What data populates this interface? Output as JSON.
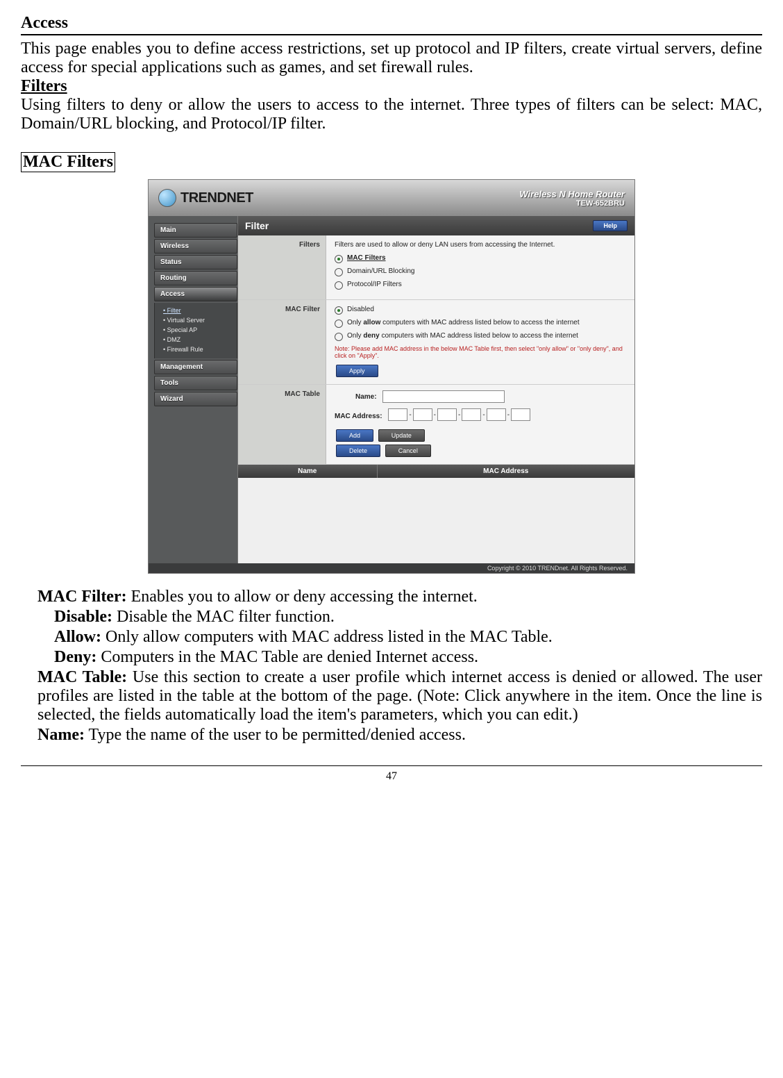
{
  "doc": {
    "access_title": "Access",
    "access_body": "This page enables you to define access restrictions, set up protocol and IP filters, create virtual servers, define access for special applications such as games, and set firewall rules.",
    "filters_title": "Filters",
    "filters_body": "Using filters to deny or allow the users to access to the internet.  Three types of filters can be select: MAC, Domain/URL blocking, and Protocol/IP filter.",
    "mac_filters_title": "MAC Filters",
    "def_mac_filter_label": "MAC Filter:",
    "def_mac_filter_body": " Enables you to allow or deny accessing the internet.",
    "def_disable_label": "Disable:",
    "def_disable_body": " Disable the MAC filter function.",
    "def_allow_label": "Allow:",
    "def_allow_body": " Only allow computers with MAC address listed in the MAC Table.",
    "def_deny_label": "Deny:",
    "def_deny_body": " Computers in the MAC Table are denied Internet access.",
    "def_mac_table_label": "MAC Table:",
    "def_mac_table_body": " Use this section to create a user profile which internet access is denied or allowed.  The user profiles are listed in the table at the bottom of the page.  (Note: Click anywhere in the item. Once the line is selected, the fields automatically load the item's parameters, which you can edit.)",
    "def_name_label": "Name:",
    "def_name_body": " Type the name of the user to be permitted/denied access.",
    "page_number": "47"
  },
  "router": {
    "brand": "TRENDNET",
    "product_line": "Wireless N Home Router",
    "model": "TEW-652BRU",
    "panel_title": "Filter",
    "help": "Help",
    "nav": {
      "main": "Main",
      "wireless": "Wireless",
      "status": "Status",
      "routing": "Routing",
      "access": "Access",
      "management": "Management",
      "tools": "Tools",
      "wizard": "Wizard"
    },
    "sub": {
      "filter": "Filter",
      "virtual_server": "Virtual Server",
      "special_ap": "Special AP",
      "dmz": "DMZ",
      "firewall_rule": "Firewall Rule"
    },
    "rows": {
      "filters_label": "Filters",
      "filters_desc": "Filters are used to allow or deny LAN users from accessing the Internet.",
      "opt_mac": "MAC Filters",
      "opt_domain": "Domain/URL Blocking",
      "opt_protocol": "Protocol/IP Filters",
      "mac_filter_label": "MAC Filter",
      "mf_disabled": "Disabled",
      "mf_allow": "computers with MAC address listed below to access the internet",
      "mf_allow_prefix": "Only ",
      "mf_allow_bold": "allow",
      "mf_deny_prefix": "Only ",
      "mf_deny_bold": "deny",
      "mf_deny": "computers with MAC address listed below to access the internet",
      "note": "Note: Please add MAC address in the below MAC Table first, then select \"only allow\" or \"only deny\", and click on \"Apply\".",
      "apply": "Apply",
      "mac_table_label": "MAC Table",
      "name_label": "Name:",
      "mac_addr_label": "MAC Address:",
      "add": "Add",
      "update": "Update",
      "delete": "Delete",
      "cancel": "Cancel",
      "th_name": "Name",
      "th_mac": "MAC Address"
    },
    "copyright": "Copyright © 2010 TRENDnet. All Rights Reserved."
  }
}
